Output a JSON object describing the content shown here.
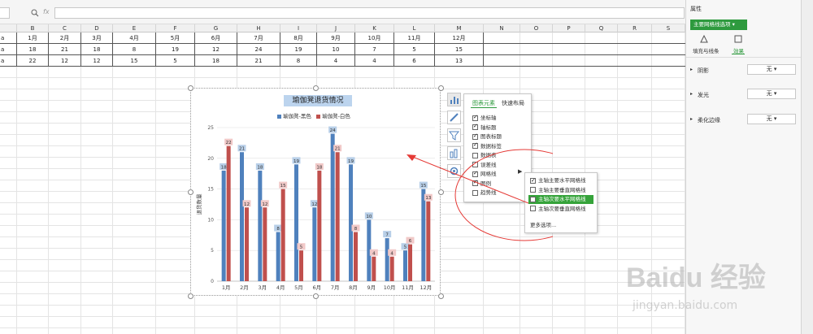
{
  "formula_bar": {
    "fx": "fx"
  },
  "columns": [
    "B",
    "C",
    "D",
    "E",
    "F",
    "G",
    "H",
    "I",
    "J",
    "K",
    "L",
    "M",
    "N",
    "O",
    "P",
    "Q",
    "R",
    "S"
  ],
  "rows": [
    {
      "label": "a",
      "cells": [
        "1月",
        "2月",
        "3月",
        "4月",
        "5月",
        "6月",
        "7月",
        "8月",
        "9月",
        "10月",
        "11月",
        "12月"
      ]
    },
    {
      "label": "a",
      "cells": [
        "18",
        "21",
        "18",
        "8",
        "19",
        "12",
        "24",
        "19",
        "10",
        "7",
        "5",
        "15"
      ]
    },
    {
      "label": "a",
      "cells": [
        "22",
        "12",
        "12",
        "15",
        "5",
        "18",
        "21",
        "8",
        "4",
        "4",
        "6",
        "13"
      ]
    }
  ],
  "chart_data": {
    "type": "bar",
    "title": "瑜伽凳退货情况",
    "ylabel": "退货数量",
    "xlabel": "",
    "ylim": [
      0,
      25
    ],
    "yticks": [
      0,
      5,
      10,
      15,
      20,
      25
    ],
    "categories": [
      "1月",
      "2月",
      "3月",
      "4月",
      "5月",
      "6月",
      "7月",
      "8月",
      "9月",
      "10月",
      "11月",
      "12月"
    ],
    "series": [
      {
        "name": "瑜伽凳-黑色",
        "color": "#4f81bd",
        "values": [
          18,
          21,
          18,
          8,
          19,
          12,
          24,
          19,
          10,
          7,
          5,
          15
        ]
      },
      {
        "name": "瑜伽凳-白色",
        "color": "#c0504d",
        "values": [
          22,
          12,
          12,
          15,
          5,
          18,
          21,
          8,
          4,
          4,
          6,
          13
        ]
      }
    ]
  },
  "chart_elements": {
    "tabs": [
      "图表元素",
      "快速布局"
    ],
    "options": [
      {
        "label": "坐标轴",
        "checked": true
      },
      {
        "label": "轴标题",
        "checked": true
      },
      {
        "label": "图表标题",
        "checked": true
      },
      {
        "label": "数据标签",
        "checked": true
      },
      {
        "label": "数据表",
        "checked": false
      },
      {
        "label": "误差线",
        "checked": false
      },
      {
        "label": "网格线",
        "checked": true
      },
      {
        "label": "图例",
        "checked": true
      },
      {
        "label": "趋势线",
        "checked": false
      }
    ],
    "submenu": [
      {
        "label": "主轴主要水平网格线",
        "checked": true
      },
      {
        "label": "主轴主要垂直网格线",
        "checked": false
      },
      {
        "label": "主轴次要水平网格线",
        "checked": false
      },
      {
        "label": "主轴次要垂直网格线",
        "checked": false
      }
    ],
    "more": "更多选项..."
  },
  "panel": {
    "title": "属性",
    "dropdown": "主要网格线选项",
    "tab_fill": "填充与线条",
    "tab_effect": "效果",
    "rows": [
      {
        "label": "阴影",
        "value": "无"
      },
      {
        "label": "发光",
        "value": "无"
      },
      {
        "label": "柔化边缘",
        "value": "无"
      }
    ]
  },
  "watermark": {
    "brand": "Baidu 经验",
    "url": "jingyan.baidu.com"
  }
}
